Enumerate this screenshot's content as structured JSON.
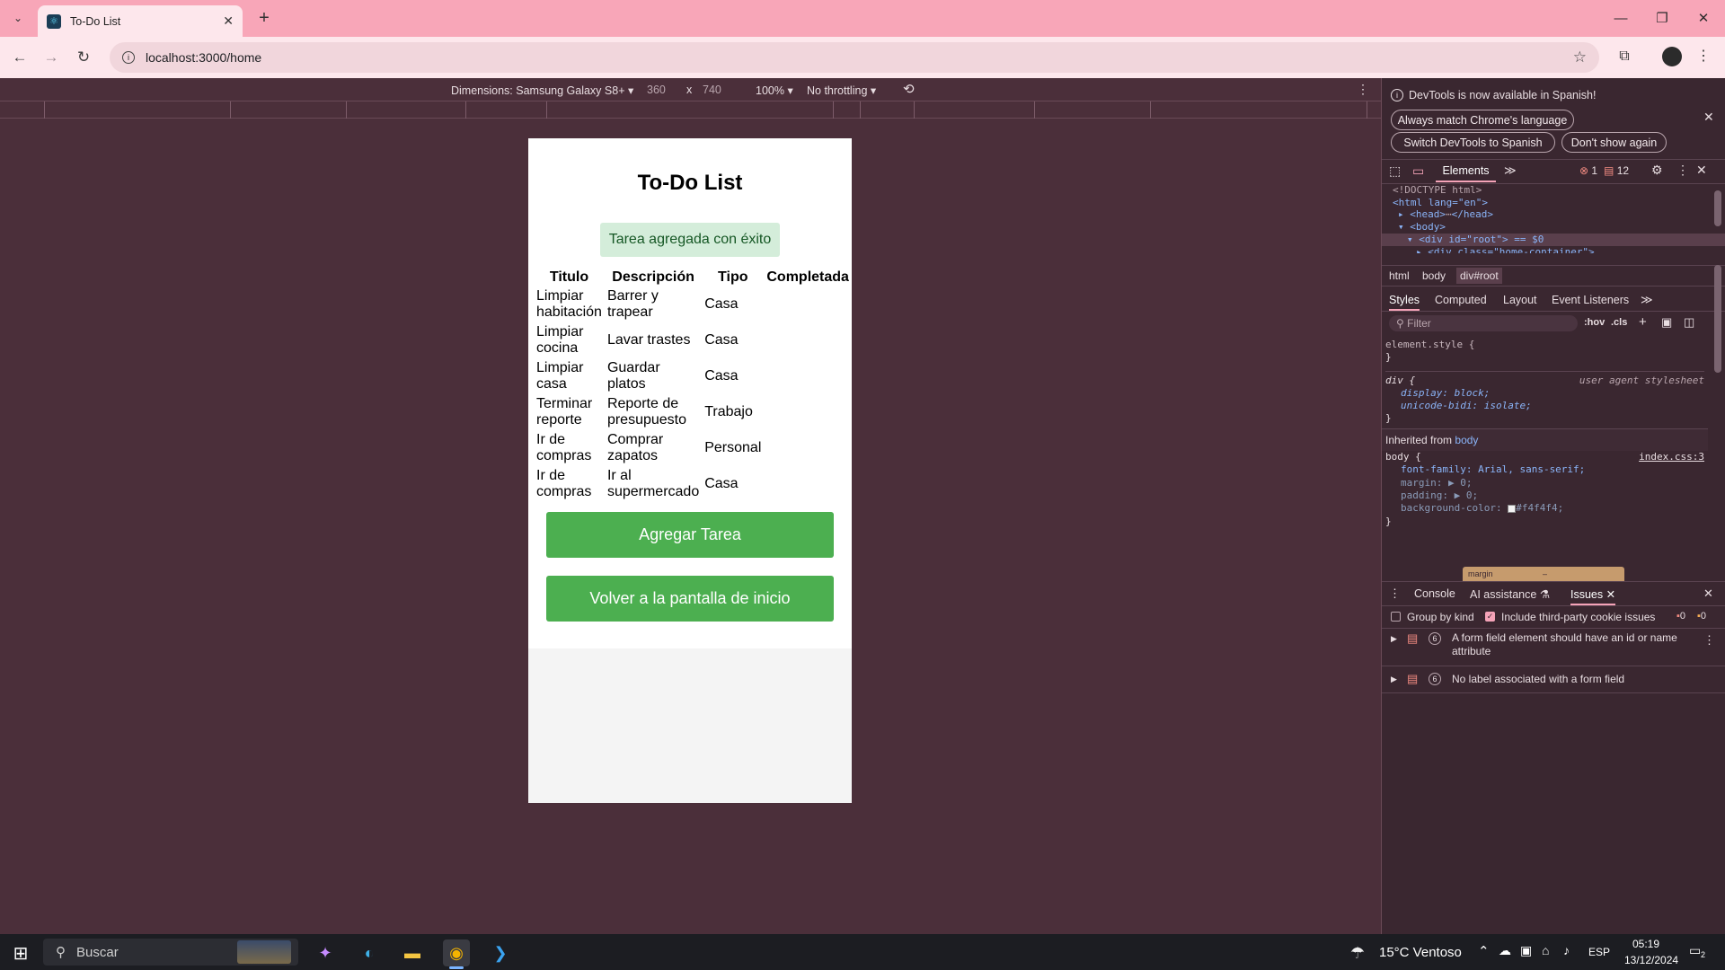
{
  "browser": {
    "tab_title": "To-Do List",
    "url": "localhost:3000/home"
  },
  "emulation": {
    "device": "Dimensions: Samsung Galaxy S8+",
    "width": "360",
    "x": "x",
    "height": "740",
    "zoom": "100%",
    "throttling": "No throttling"
  },
  "app": {
    "title": "To-Do List",
    "message": "Tarea agregada con éxito",
    "headers": [
      "Titulo",
      "Descripción",
      "Tipo",
      "Completada"
    ],
    "rows": [
      [
        "Limpiar habitación",
        "Barrer y trapear",
        "Casa",
        ""
      ],
      [
        "Limpiar cocina",
        "Lavar trastes",
        "Casa",
        ""
      ],
      [
        "Limpiar casa",
        "Guardar platos",
        "Casa",
        ""
      ],
      [
        "Terminar reporte",
        "Reporte de presupuesto",
        "Trabajo",
        ""
      ],
      [
        "Ir de compras",
        "Comprar zapatos",
        "Personal",
        ""
      ],
      [
        "Ir de compras",
        "Ir al supermercado",
        "Casa",
        ""
      ]
    ],
    "add_button": "Agregar Tarea",
    "back_button": "Volver a la pantalla de inicio"
  },
  "devtools": {
    "banner": "DevTools is now available in Spanish!",
    "btn_match": "Always match Chrome's language",
    "btn_switch": "Switch DevTools to Spanish",
    "btn_dont": "Don't show again",
    "tab_elements": "Elements",
    "errors": "1",
    "messages": "12",
    "dom": [
      "<!DOCTYPE html>",
      "<html lang=\"en\">",
      "<head>",
      "</head>",
      "<body>",
      "<div id=\"root\"> == $0",
      "<div class=\"home-container\">"
    ],
    "breadcrumbs": [
      "html",
      "body",
      "div#root"
    ],
    "style_tabs": [
      "Styles",
      "Computed",
      "Layout",
      "Event Listeners"
    ],
    "filter_placeholder": "Filter",
    "hov": ":hov",
    "cls": ".cls",
    "css": {
      "element_style": "element.style {",
      "close": "}",
      "div_sel": "div {",
      "ua": "user agent stylesheet",
      "display": "display: block;",
      "unicode": "unicode-bidi: isolate;",
      "inherited": "Inherited from",
      "inherited_link": "body",
      "body_sel": "body {",
      "source": "index.css:3",
      "font": "font-family: Arial, sans-serif;",
      "margin": "margin: ▶ 0;",
      "padding": "padding: ▶ 0;",
      "bg": "background-color:",
      "bg_val": "#f4f4f4;",
      "box_margin": "margin",
      "box_dash": "–"
    },
    "drawer_tabs": [
      "Console",
      "AI assistance",
      "Issues"
    ],
    "group_by_kind": "Group by kind",
    "include_third": "Include third-party cookie issues",
    "issue_counts": [
      "0",
      "0"
    ],
    "issues": [
      {
        "count": "6",
        "text": "A form field element should have an id or name attribute"
      },
      {
        "count": "6",
        "text": "No label associated with a form field"
      }
    ]
  },
  "taskbar": {
    "search": "Buscar",
    "weather": "15°C Ventoso",
    "lang": "ESP",
    "time": "05:19",
    "date": "13/12/2024",
    "notif": "2"
  },
  "colors": {
    "page_bg": "#4b2f3a",
    "tab_bar": "#f8a6b8",
    "button_green": "#4caf50",
    "success_bg": "#d4edda"
  }
}
